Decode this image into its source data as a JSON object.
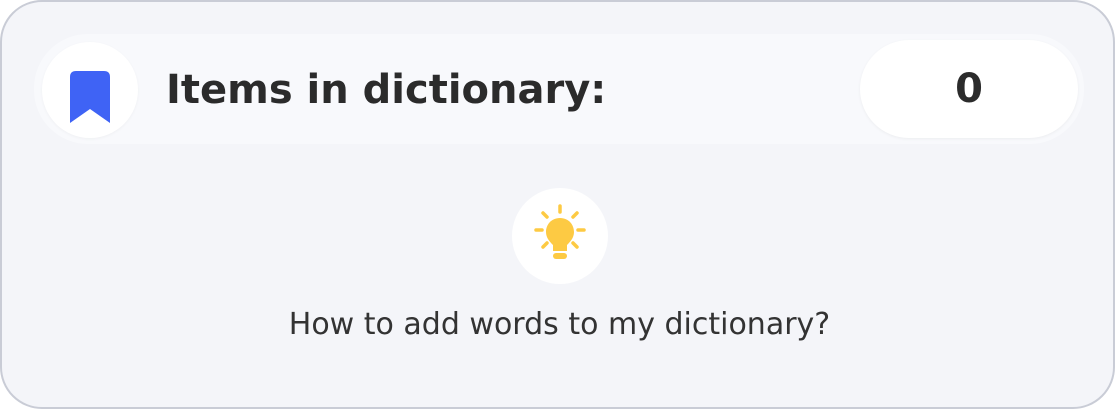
{
  "header": {
    "title": "Items in dictionary:",
    "count": "0",
    "icon": "bookmark-icon"
  },
  "help": {
    "icon": "lightbulb-icon",
    "link_text": "How to add words to my dictionary?"
  },
  "colors": {
    "accent": "#3f63f5",
    "bulb": "#fdca43",
    "card_background": "#f4f5f9",
    "text": "#2b2b2b"
  }
}
